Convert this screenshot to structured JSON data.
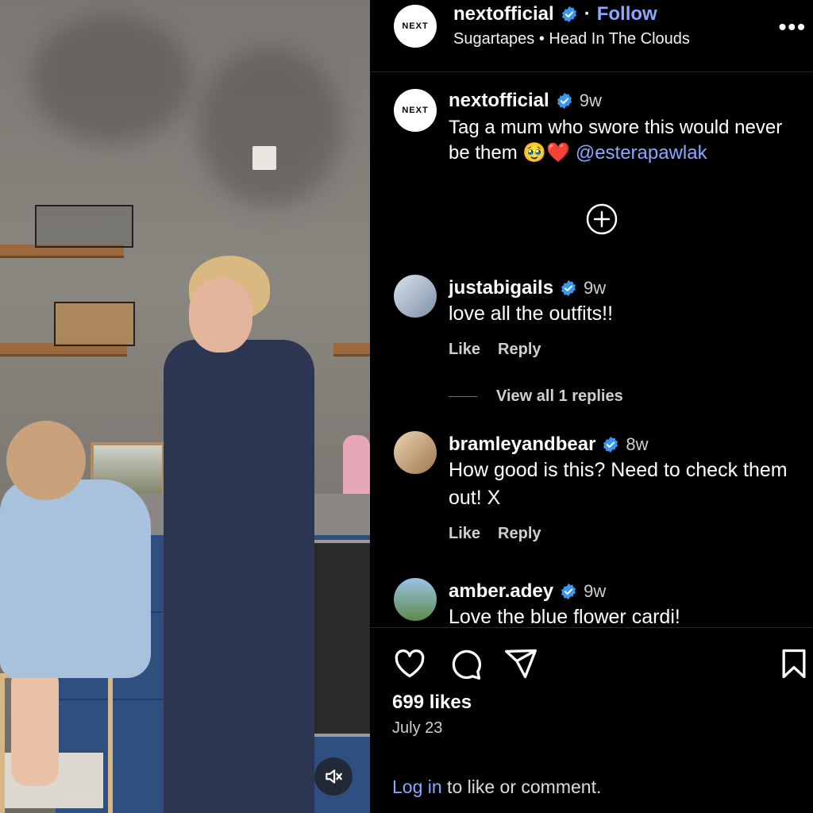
{
  "post": {
    "username": "nextofficial",
    "logo_text": "NEXT",
    "follow_label": "Follow",
    "audio": "Sugartapes • Head In The Clouds",
    "more_label": "•••"
  },
  "caption": {
    "username": "nextofficial",
    "time": "9w",
    "text": "Tag a mum who swore this would never be them 🥹❤️",
    "mention": "@esterapawlak"
  },
  "comments": [
    {
      "username": "justabigails",
      "time": "9w",
      "text": "love all the outfits!!",
      "like_label": "Like",
      "reply_label": "Reply"
    },
    {
      "username": "bramleyandbear",
      "time": "8w",
      "text": "How good is this? Need to check them out! X",
      "like_label": "Like",
      "reply_label": "Reply"
    },
    {
      "username": "amber.adey",
      "time": "9w",
      "text": "Love the blue flower cardi!"
    }
  ],
  "view_replies_label": "View all 1 replies",
  "footer": {
    "likes": "699 likes",
    "date": "July 23",
    "login_link": "Log in",
    "login_rest": " to like or comment."
  },
  "colors": {
    "background": "#000000",
    "link": "#8aa8ff",
    "verified": "#3897f0",
    "muted_text": "#cfcfcf"
  },
  "icons": [
    "verified-icon",
    "more-icon",
    "add-comment-icon",
    "heart-icon",
    "comment-icon",
    "share-icon",
    "bookmark-icon",
    "mute-icon"
  ]
}
